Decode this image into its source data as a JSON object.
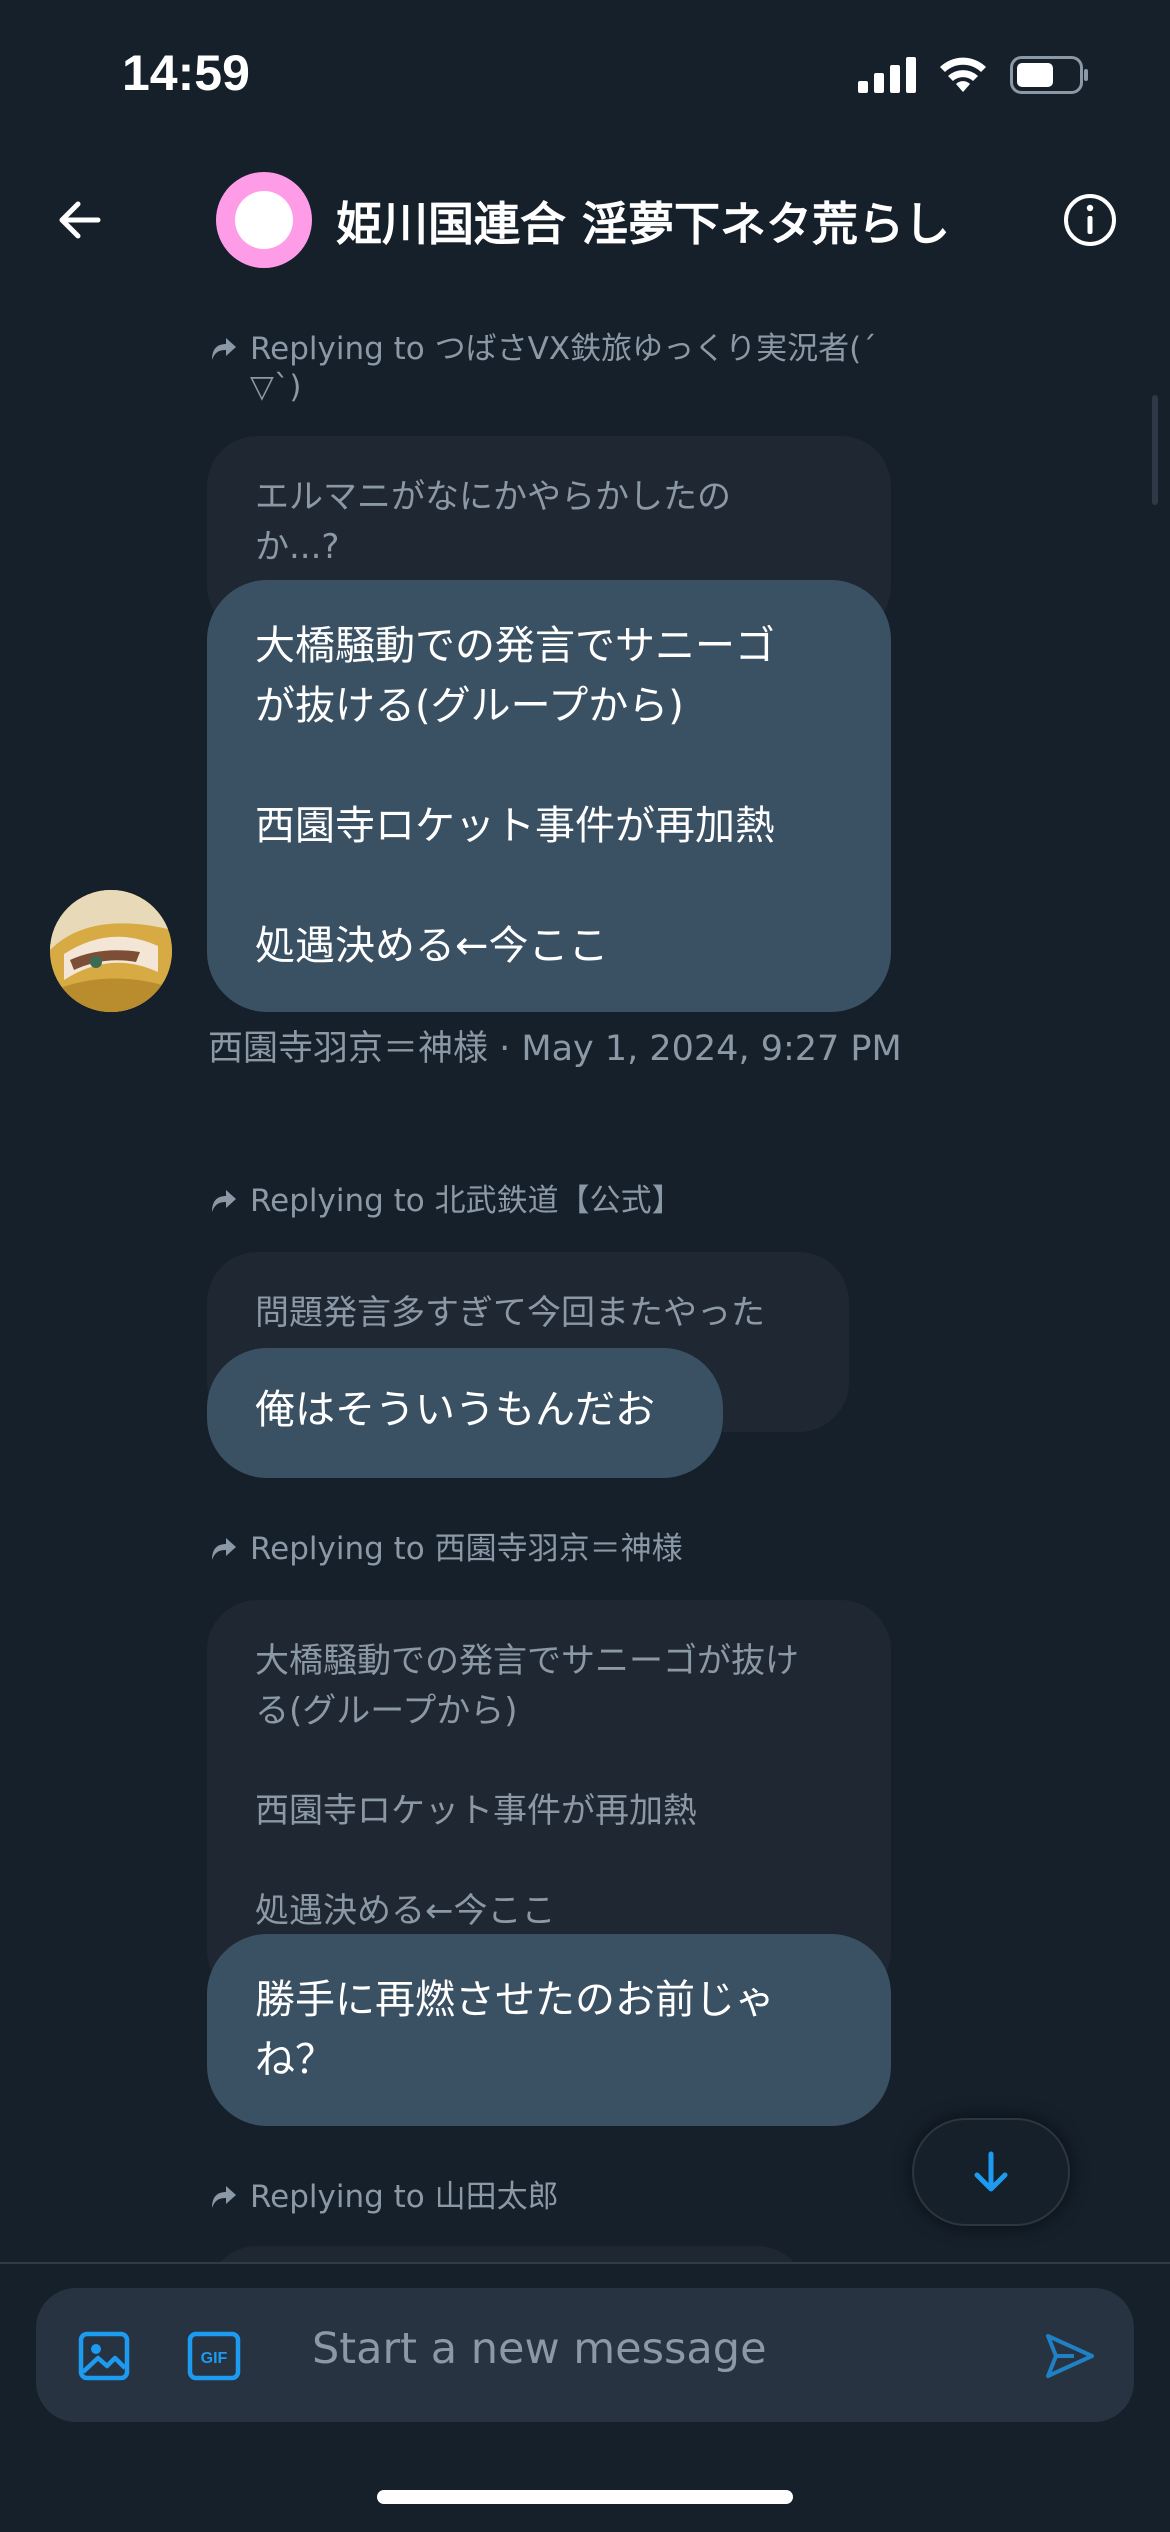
{
  "status_bar": {
    "time": "14:59"
  },
  "header": {
    "title": "姫川国連合 淫夢下ネタ荒らし"
  },
  "messages": [
    {
      "reply_to": "Replying to つばさVX鉄旅ゆっくり実況者(´\n▽`)",
      "quoted": "エルマニがなにかやらかしたの\nか...?",
      "text": "大橋騒動での発言でサニーゴ\nが抜ける(グループから)\n\n西園寺ロケット事件が再加熱\n\n処遇決める←今ここ",
      "meta": "西園寺羽京＝神様 · May 1, 2024, 9:27 PM"
    },
    {
      "reply_to": "Replying to 北武鉄道【公式】",
      "quoted": "問題発言多すぎて今回またやった",
      "text": "俺はそういうもんだお"
    },
    {
      "reply_to": "Replying to 西園寺羽京＝神様",
      "quoted": "大橋騒動での発言でサニーゴが抜け\nる(グループから)\n\n西園寺ロケット事件が再加熱\n\n処遇決める←今ここ",
      "text": "勝手に再燃させたのお前じゃ\nね？"
    },
    {
      "reply_to": "Replying to 山田太郎"
    }
  ],
  "composer": {
    "placeholder": "Start a new message",
    "gif_label": "GIF"
  },
  "colors": {
    "accent": "#1d9bf0",
    "background": "#15202b",
    "bubble": "#3a5063",
    "quoted": "#1e2732"
  }
}
